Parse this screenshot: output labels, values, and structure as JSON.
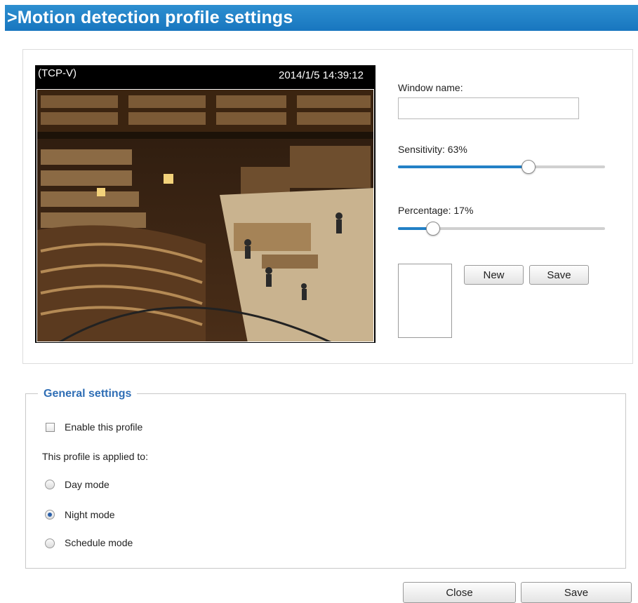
{
  "header": {
    "title": ">Motion detection profile settings"
  },
  "video": {
    "stream_label": "(TCP-V)",
    "timestamp": "2014/1/5 14:39:12"
  },
  "window": {
    "name_label": "Window name:",
    "name_value": ""
  },
  "sensitivity": {
    "label": "Sensitivity: 63%",
    "value_percent": 63
  },
  "percentage": {
    "label": "Percentage: 17%",
    "value_percent": 17
  },
  "buttons": {
    "new_label": "New",
    "save_label": "Save"
  },
  "general": {
    "legend": "General settings",
    "enable_label": "Enable this profile",
    "enable_checked": false,
    "applied_label": "This profile is applied to:",
    "modes": [
      {
        "label": "Day mode",
        "checked": false
      },
      {
        "label": "Night mode",
        "checked": true
      },
      {
        "label": "Schedule mode",
        "checked": false
      }
    ]
  },
  "footer": {
    "close_label": "Close",
    "save_label": "Save"
  },
  "colors": {
    "header_blue": "#1f80c7",
    "accent": "#2280c6",
    "legend_text": "#2f6eb5"
  }
}
